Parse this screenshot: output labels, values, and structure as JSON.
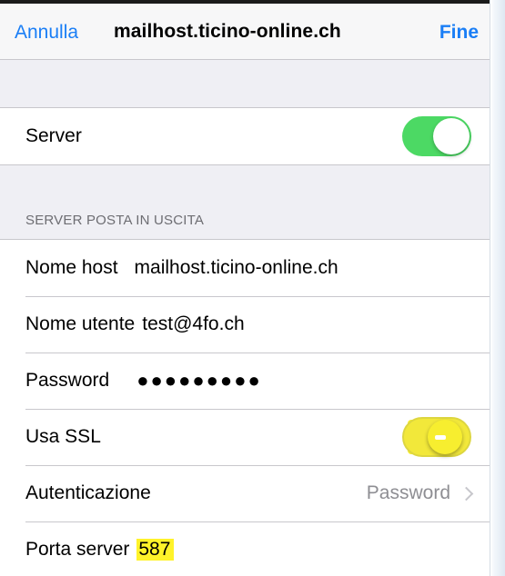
{
  "navbar": {
    "cancel_label": "Annulla",
    "title": "mailhost.ticino-online.ch",
    "done_label": "Fine"
  },
  "server_group": {
    "server_label": "Server",
    "server_enabled": true
  },
  "outgoing": {
    "section_header": "SERVER POSTA IN USCITA",
    "hostname_label": "Nome host",
    "hostname_value": "mailhost.ticino-online.ch",
    "username_label": "Nome utente",
    "username_value": "test@4fo.ch",
    "password_label": "Password",
    "password_value": "●●●●●●●●●",
    "ssl_label": "Usa SSL",
    "ssl_enabled": false,
    "auth_label": "Autenticazione",
    "auth_value": "Password",
    "port_label": "Porta server",
    "port_value": "587"
  },
  "colors": {
    "ios_blue": "#1a7ef6",
    "toggle_on": "#4cd964",
    "highlight": "#fff32a",
    "group_bg": "#efeff4"
  }
}
